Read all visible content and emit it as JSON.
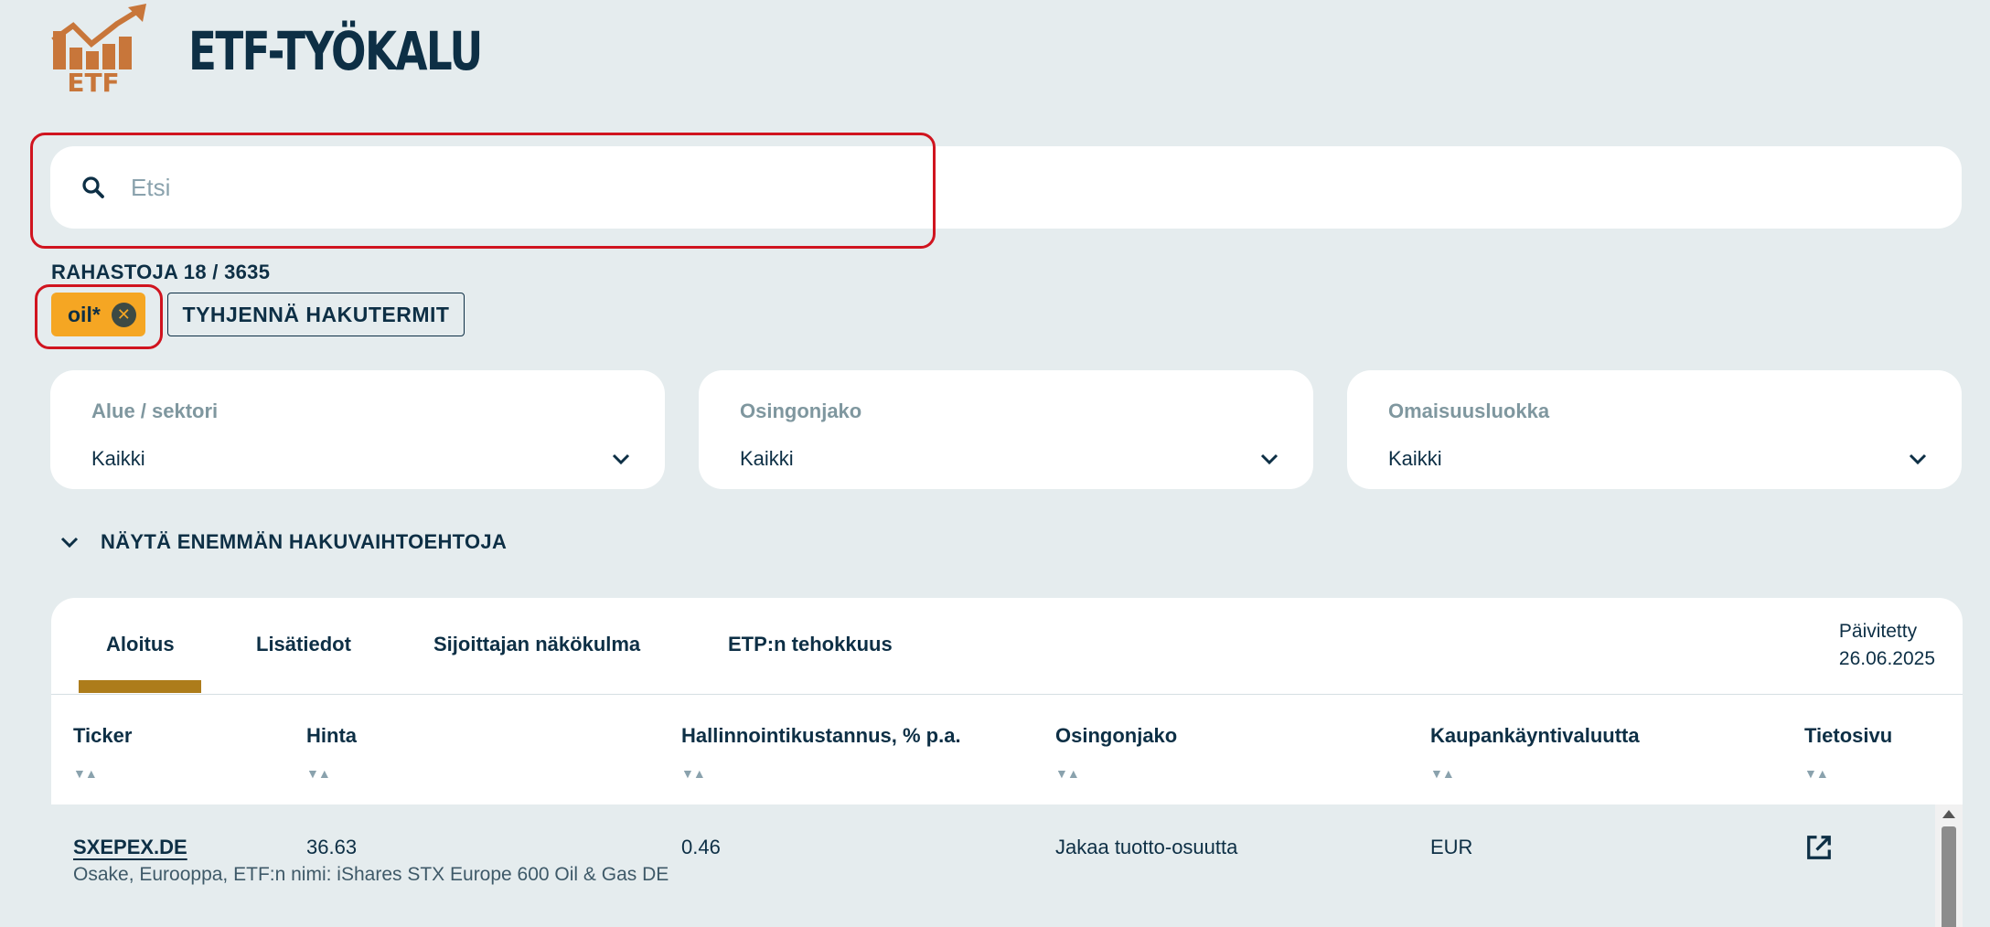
{
  "header": {
    "title": "ETF-TYÖKALU",
    "logo_text": "ETF"
  },
  "search": {
    "placeholder": "Etsi",
    "value": ""
  },
  "results": {
    "count_label": "RAHASTOJA 18 / 3635"
  },
  "active_terms": [
    {
      "label": "oil*"
    }
  ],
  "clear_button_label": "TYHJENNÄ HAKUTERMIT",
  "filters": [
    {
      "label": "Alue / sektori",
      "value": "Kaikki"
    },
    {
      "label": "Osingonjako",
      "value": "Kaikki"
    },
    {
      "label": "Omaisuusluokka",
      "value": "Kaikki"
    }
  ],
  "more_options_label": "NÄYTÄ ENEMMÄN HAKUVAIHTOEHTOJA",
  "tabs": [
    {
      "label": "Aloitus",
      "active": true
    },
    {
      "label": "Lisätiedot",
      "active": false
    },
    {
      "label": "Sijoittajan näkökulma",
      "active": false
    },
    {
      "label": "ETP:n tehokkuus",
      "active": false
    }
  ],
  "updated": {
    "label": "Päivitetty",
    "date": "26.06.2025"
  },
  "columns": [
    "Ticker",
    "Hinta",
    "Hallinnointikustannus, % p.a.",
    "Osingonjako",
    "Kaupankäyntivaluutta",
    "Tietosivu"
  ],
  "rows": [
    {
      "ticker": "SXEPEX.DE",
      "price": "36.63",
      "fee": "0.46",
      "distribution": "Jakaa tuotto-osuutta",
      "currency": "EUR",
      "description": "Osake, Eurooppa, ETF:n nimi: iShares STX Europe 600 Oil & Gas DE"
    }
  ],
  "colors": {
    "accent": "#f5a623",
    "tab_underline": "#ad7c1b",
    "highlight": "#d0141f",
    "logo": "#c8763a"
  },
  "icons": {
    "search": "search-icon",
    "chevron": "chevron-down-icon",
    "clear": "close-circle-icon",
    "external": "open-in-new-icon"
  }
}
